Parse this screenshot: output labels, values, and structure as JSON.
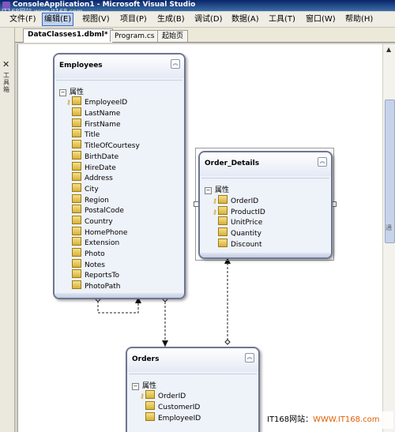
{
  "window": {
    "title": "ConsoleApplication1 - Microsoft Visual Studio"
  },
  "watermark_top": "IT168网站 www.it168.com",
  "menu": {
    "items": [
      {
        "label": "文件(F)"
      },
      {
        "label": "编辑(E)"
      },
      {
        "label": "视图(V)"
      },
      {
        "label": "项目(P)"
      },
      {
        "label": "生成(B)"
      },
      {
        "label": "调试(D)"
      },
      {
        "label": "数据(A)"
      },
      {
        "label": "工具(T)"
      },
      {
        "label": "窗口(W)"
      },
      {
        "label": "帮助(H)"
      }
    ]
  },
  "toolbox": {
    "label": "工具箱"
  },
  "tabs": [
    {
      "label": "DataClasses1.dbml*"
    },
    {
      "label": "Program.cs"
    },
    {
      "label": "起始页"
    }
  ],
  "designer": {
    "entities": [
      {
        "name": "Employees",
        "section": "属性",
        "properties": [
          {
            "name": "EmployeeID",
            "key": true
          },
          {
            "name": "LastName"
          },
          {
            "name": "FirstName"
          },
          {
            "name": "Title"
          },
          {
            "name": "TitleOfCourtesy"
          },
          {
            "name": "BirthDate"
          },
          {
            "name": "HireDate"
          },
          {
            "name": "Address"
          },
          {
            "name": "City"
          },
          {
            "name": "Region"
          },
          {
            "name": "PostalCode"
          },
          {
            "name": "Country"
          },
          {
            "name": "HomePhone"
          },
          {
            "name": "Extension"
          },
          {
            "name": "Photo"
          },
          {
            "name": "Notes"
          },
          {
            "name": "ReportsTo"
          },
          {
            "name": "PhotoPath"
          }
        ]
      },
      {
        "name": "Order_Details",
        "section": "属性",
        "properties": [
          {
            "name": "OrderID",
            "key": true
          },
          {
            "name": "ProductID",
            "key": true
          },
          {
            "name": "UnitPrice"
          },
          {
            "name": "Quantity"
          },
          {
            "name": "Discount"
          }
        ]
      },
      {
        "name": "Orders",
        "section": "属性",
        "properties": [
          {
            "name": "OrderID",
            "key": true
          },
          {
            "name": "CustomerID"
          },
          {
            "name": "EmployeeID"
          }
        ]
      }
    ]
  },
  "side_char": "通",
  "watermark": {
    "part1": "IT168网站：",
    "part2": "WWW.IT168.com"
  }
}
